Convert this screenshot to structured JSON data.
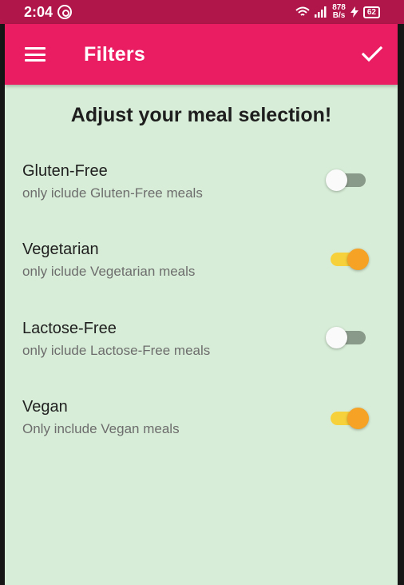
{
  "status_bar": {
    "time": "2:04",
    "net_speed_value": "878",
    "net_speed_unit": "B/s",
    "battery": "62"
  },
  "app_bar": {
    "title": "Filters",
    "menu_icon": "hamburger-menu-icon",
    "save_icon": "check-icon",
    "color": "#ea1d63"
  },
  "page": {
    "heading": "Adjust your meal selection!",
    "background": "#d7edd7"
  },
  "filters": [
    {
      "title": "Gluten-Free",
      "subtitle": "only iclude Gluten-Free meals",
      "enabled": false
    },
    {
      "title": "Vegetarian",
      "subtitle": "only iclude Vegetarian meals",
      "enabled": true
    },
    {
      "title": "Lactose-Free",
      "subtitle": "only iclude Lactose-Free meals",
      "enabled": false
    },
    {
      "title": "Vegan",
      "subtitle": "Only include Vegan meals",
      "enabled": true
    }
  ],
  "colors": {
    "status_bar": "#b0164a",
    "switch_on_thumb": "#f5a225",
    "switch_on_track": "#f7d13c",
    "switch_off_thumb": "#fafafa",
    "switch_off_track": "#8a9a8a"
  }
}
